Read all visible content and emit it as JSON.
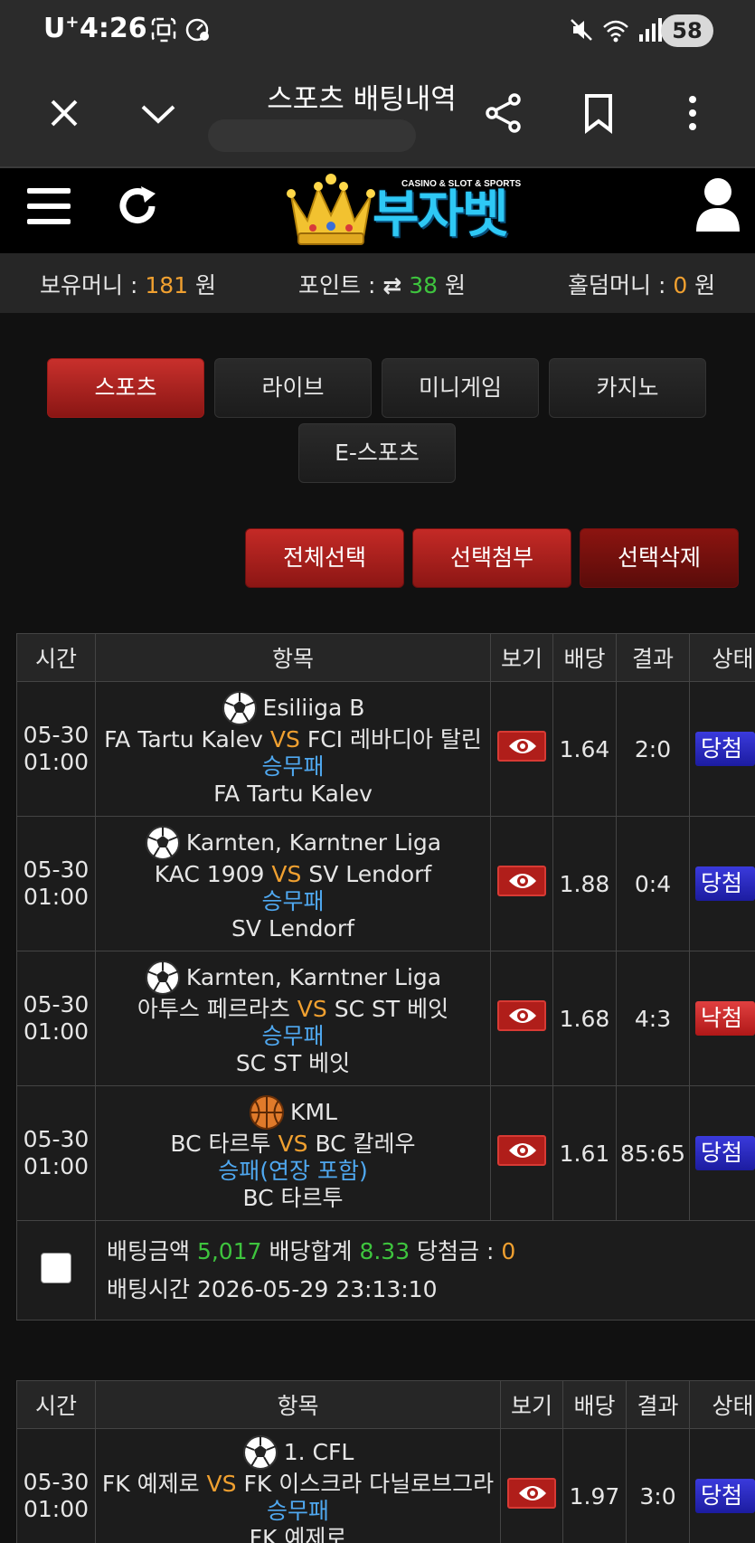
{
  "status_bar": {
    "carrier": "U",
    "carrier_sup": "+",
    "time": "4:26",
    "battery": "58"
  },
  "browser": {
    "title": "스포츠 배팅내역"
  },
  "site": {
    "logo_tagline": "CASINO & SLOT & SPORTS",
    "logo_text": "부자벳"
  },
  "money": {
    "holding_label": "보유머니 : ",
    "holding_value": "181",
    "holding_unit": " 원",
    "point_label": "포인트 : ",
    "point_value": "38",
    "point_unit": " 원",
    "holdem_label": "홀덤머니 : ",
    "holdem_value": "0",
    "holdem_unit": " 원"
  },
  "tabs": [
    "스포츠",
    "라이브",
    "미니게임",
    "카지노",
    "E-스포츠"
  ],
  "actions": {
    "select_all": "전체선택",
    "attach": "선택첨부",
    "delete": "선택삭제"
  },
  "table_headers": {
    "time": "시간",
    "item": "항목",
    "view": "보기",
    "odds": "배당",
    "result": "결과",
    "status": "상태"
  },
  "bet_slip_1": {
    "rows": [
      {
        "date": "05-30",
        "time": "01:00",
        "sport": "soccer",
        "league": "Esiliiga B",
        "home": "FA Tartu Kalev",
        "vs": "VS",
        "away": "FCI 레바디아 탈린",
        "market": "승무패",
        "pick": "FA Tartu Kalev",
        "odds": "1.64",
        "result": "2:0",
        "status": "당첨",
        "status_type": "win"
      },
      {
        "date": "05-30",
        "time": "01:00",
        "sport": "soccer",
        "league": "Karnten, Karntner Liga",
        "home": "KAC 1909",
        "vs": "VS",
        "away": "SV Lendorf",
        "market": "승무패",
        "pick": "SV Lendorf",
        "odds": "1.88",
        "result": "0:4",
        "status": "당첨",
        "status_type": "win"
      },
      {
        "date": "05-30",
        "time": "01:00",
        "sport": "soccer",
        "league": "Karnten, Karntner Liga",
        "home": "아투스 페르라츠",
        "vs": "VS",
        "away": "SC ST 베잇",
        "market": "승무패",
        "pick": "SC ST 베잇",
        "odds": "1.68",
        "result": "4:3",
        "status": "낙첨",
        "status_type": "lose"
      },
      {
        "date": "05-30",
        "time": "01:00",
        "sport": "basketball",
        "league": "KML",
        "home": "BC 타르투",
        "vs": "VS",
        "away": "BC 칼레우",
        "market": "승패(연장 포함)",
        "pick": "BC 타르투",
        "odds": "1.61",
        "result": "85:65",
        "status": "당첨",
        "status_type": "win"
      }
    ],
    "summary": {
      "amount_label": "배팅금액 ",
      "amount_value": "5,017",
      "total_label": " 배당합계 ",
      "total_value": "8.33",
      "win_label": " 당첨금 : ",
      "win_value": "0",
      "time_label": "배팅시간 ",
      "time_value": "2026-05-29 23:13:10"
    }
  },
  "bet_slip_2": {
    "rows": [
      {
        "date": "05-30",
        "time": "01:00",
        "sport": "soccer",
        "league": "1. CFL",
        "home": "FK 예제로",
        "vs": "VS",
        "away": "FK 이스크라 다닐로브그라",
        "market": "승무패",
        "pick": "FK 예제로",
        "odds": "1.97",
        "result": "3:0",
        "status": "당첨",
        "status_type": "win"
      }
    ]
  },
  "colors": {
    "accent_red": "#b01e1a",
    "win_blue": "#2626c0",
    "lose_red": "#d03030",
    "odds_green": "#3ec43e",
    "orange": "#f0a030",
    "market_blue": "#4fa8f0"
  }
}
